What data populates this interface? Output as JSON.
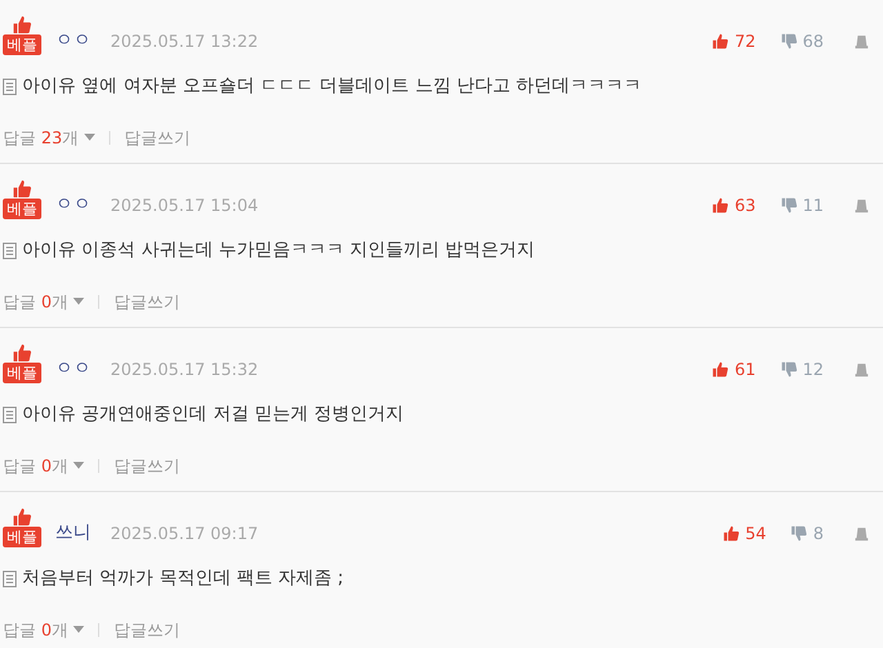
{
  "comments": [
    {
      "badge": "베플",
      "author": "ㅇㅇ",
      "date": "2025.05.17 13:22",
      "likes": "72",
      "dislikes": "68",
      "text": "아이유 옆에 여자분 오프숄더 ㄷㄷㄷ 더블데이트 느낌 난다고 하던데ㅋㅋㅋㅋ",
      "reply_label": "답글",
      "reply_count": "23",
      "reply_unit": "개",
      "write_reply": "답글쓰기"
    },
    {
      "badge": "베플",
      "author": "ㅇㅇ",
      "date": "2025.05.17 15:04",
      "likes": "63",
      "dislikes": "11",
      "text": "아이유 이종석 사귀는데 누가믿음ㅋㅋㅋ 지인들끼리 밥먹은거지",
      "reply_label": "답글",
      "reply_count": "0",
      "reply_unit": "개",
      "write_reply": "답글쓰기"
    },
    {
      "badge": "베플",
      "author": "ㅇㅇ",
      "date": "2025.05.17 15:32",
      "likes": "61",
      "dislikes": "12",
      "text": "아이유 공개연애중인데 저걸 믿는게 정병인거지",
      "reply_label": "답글",
      "reply_count": "0",
      "reply_unit": "개",
      "write_reply": "답글쓰기"
    },
    {
      "badge": "베플",
      "author": "쓰니",
      "date": "2025.05.17 09:17",
      "likes": "54",
      "dislikes": "8",
      "text": "처음부터 억까가 목적인데 팩트 자제좀 ;",
      "reply_label": "답글",
      "reply_count": "0",
      "reply_unit": "개",
      "write_reply": "답글쓰기"
    }
  ]
}
